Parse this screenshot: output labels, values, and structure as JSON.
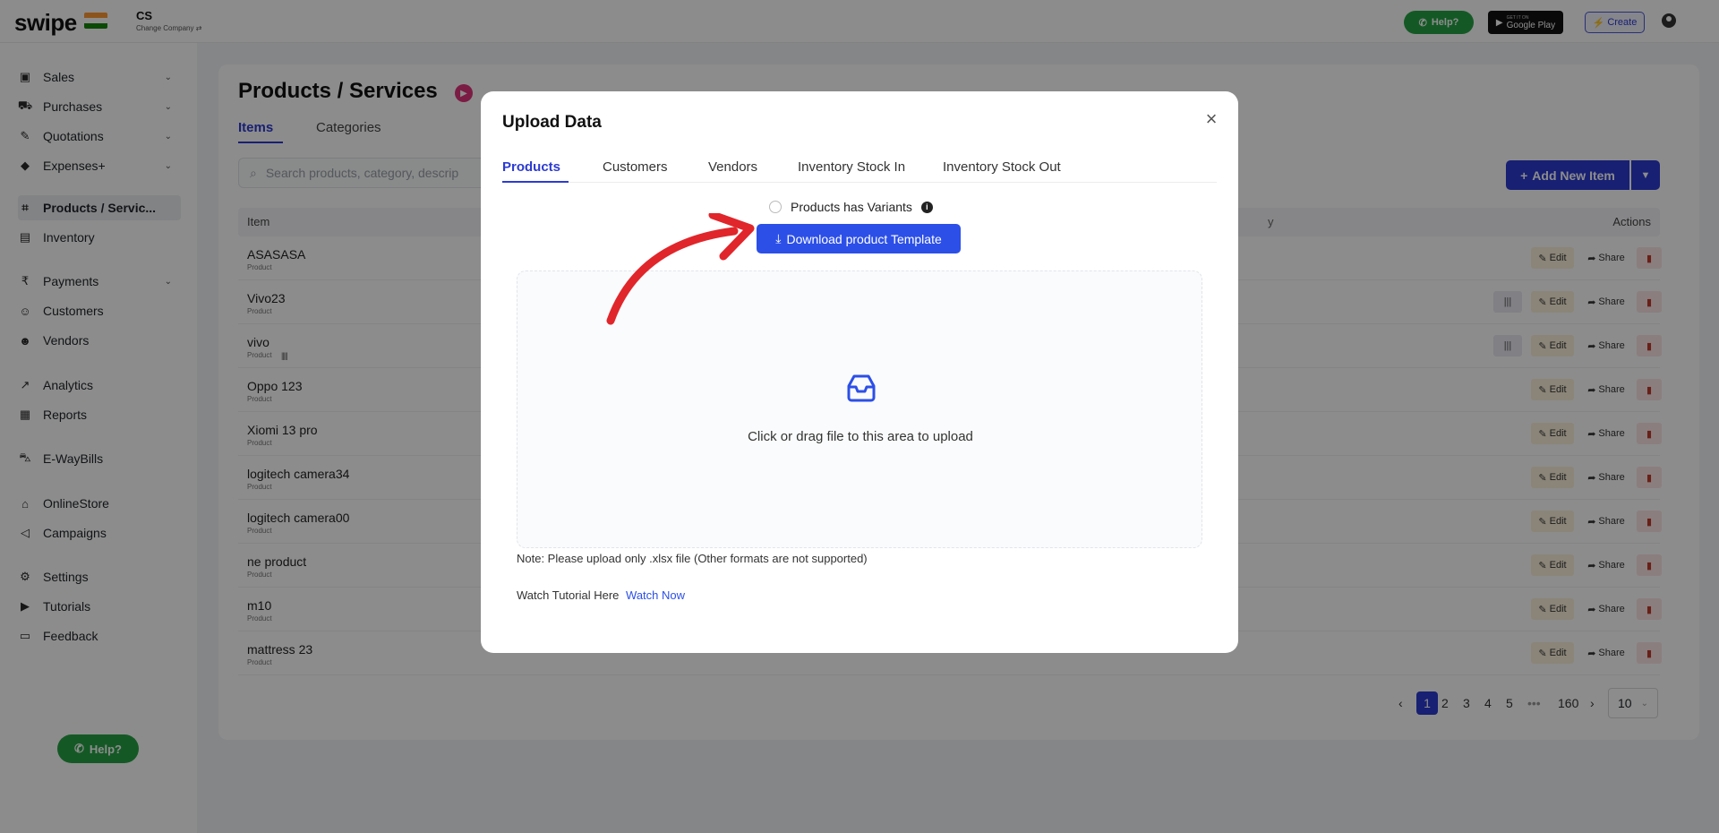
{
  "header": {
    "logo": "swipe",
    "company_name": "CS",
    "change_company": "Change Company ⇄",
    "help_label": "Help?",
    "gplay_small": "GET IT ON",
    "gplay_label": "Google Play",
    "create_label": "Create"
  },
  "sidebar": {
    "items": [
      {
        "label": "Sales",
        "icon": "sales-icon",
        "chevron": true
      },
      {
        "label": "Purchases",
        "icon": "cart-icon",
        "chevron": true
      },
      {
        "label": "Quotations",
        "icon": "pen-icon",
        "chevron": true
      },
      {
        "label": "Expenses+",
        "icon": "tag-icon",
        "chevron": true
      },
      {
        "label": "Products / Servic...",
        "icon": "products-icon",
        "chevron": false,
        "active": true
      },
      {
        "label": "Inventory",
        "icon": "inventory-icon",
        "chevron": false
      },
      {
        "label": "Payments",
        "icon": "rupee-icon",
        "chevron": true
      },
      {
        "label": "Customers",
        "icon": "customer-icon",
        "chevron": false
      },
      {
        "label": "Vendors",
        "icon": "vendor-icon",
        "chevron": false
      },
      {
        "label": "Analytics",
        "icon": "analytics-icon",
        "chevron": false
      },
      {
        "label": "Reports",
        "icon": "reports-icon",
        "chevron": false
      },
      {
        "label": "E-WayBills",
        "icon": "truck-icon",
        "chevron": false
      },
      {
        "label": "OnlineStore",
        "icon": "store-icon",
        "chevron": false
      },
      {
        "label": "Campaigns",
        "icon": "megaphone-icon",
        "chevron": false
      },
      {
        "label": "Settings",
        "icon": "gear-icon",
        "chevron": false
      },
      {
        "label": "Tutorials",
        "icon": "youtube-icon",
        "chevron": false
      },
      {
        "label": "Feedback",
        "icon": "feedback-icon",
        "chevron": false
      }
    ],
    "help_label": "Help?"
  },
  "main": {
    "title": "Products / Services",
    "tabs": [
      "Items",
      "Categories"
    ],
    "search_placeholder": "Search products, category, descrip",
    "add_button": "Add New Item",
    "table_headers": {
      "item": "Item",
      "unit": "y",
      "actions": "Actions"
    },
    "rows": [
      {
        "name": "ASASASA",
        "type": "Product",
        "barcode": false
      },
      {
        "name": "Vivo23",
        "type": "Product",
        "barcode": true
      },
      {
        "name": "vivo",
        "type": "Product",
        "barcode": true,
        "inline_barcode": true
      },
      {
        "name": "Oppo 123",
        "type": "Product",
        "barcode": false
      },
      {
        "name": "Xiomi 13 pro",
        "type": "Product",
        "barcode": false
      },
      {
        "name": "logitech camera34",
        "type": "Product",
        "barcode": false
      },
      {
        "name": "logitech camera00",
        "type": "Product",
        "barcode": false
      },
      {
        "name": "ne product",
        "type": "Product",
        "barcode": false
      },
      {
        "name": "m10",
        "type": "Product",
        "barcode": false
      },
      {
        "name": "mattress 23",
        "type": "Product",
        "barcode": false
      }
    ],
    "edit_label": "Edit",
    "share_label": "Share",
    "pagination": {
      "pages": [
        "1",
        "2",
        "3",
        "4",
        "5",
        "•••",
        "160"
      ],
      "current": "1",
      "page_size": "10"
    }
  },
  "modal": {
    "title": "Upload Data",
    "tabs": [
      "Products",
      "Customers",
      "Vendors",
      "Inventory Stock In",
      "Inventory Stock Out"
    ],
    "variants_label": "Products has Variants",
    "download_button": "Download product Template",
    "dropzone_text": "Click or drag file to this area to upload",
    "note": "Note: Please upload only .xlsx file (Other formats are not supported)",
    "tutorial_label": "Watch Tutorial Here",
    "tutorial_link": "Watch Now"
  },
  "colors": {
    "accent": "#2c3bd1",
    "download_button": "#2c4fe8",
    "help_green": "#25a244",
    "annotation_arrow": "#e0262b"
  }
}
